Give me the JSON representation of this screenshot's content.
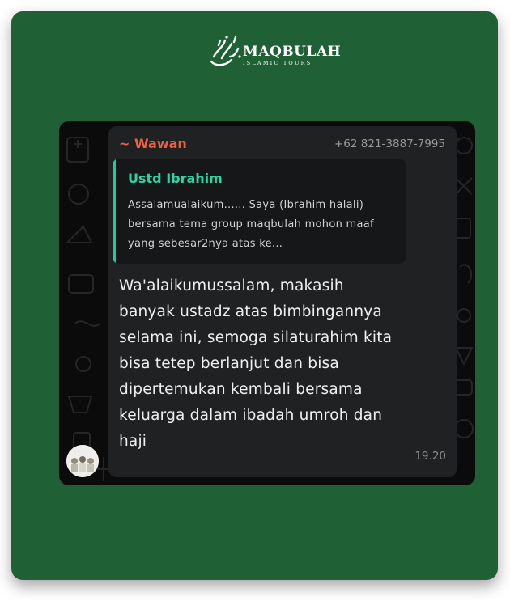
{
  "brand": {
    "name": "MAQBULAH",
    "tagline": "ISLAMIC TOURS"
  },
  "chat": {
    "sender_name": "~ Wawan",
    "sender_phone": "+62 821-3887-7995",
    "quoted": {
      "author": "Ustd Ibrahim",
      "text": "Assalamualaikum...... Saya (Ibrahim halali) bersama tema group maqbulah mohon maaf yang sebesar2nya atas ke..."
    },
    "message": "Wa'alaikumussalam, makasih banyak ustadz atas bimbingannya selama ini, semoga silaturahim kita bisa tetep berlanjut dan bisa dipertemukan kembali bersama keluarga dalam ibadah umroh dan haji",
    "time": "19.20"
  },
  "colors": {
    "card_green": "#1f6135",
    "sender_orange": "#ec6140",
    "quote_accent": "#24c99a",
    "bubble_bg": "#202122"
  }
}
